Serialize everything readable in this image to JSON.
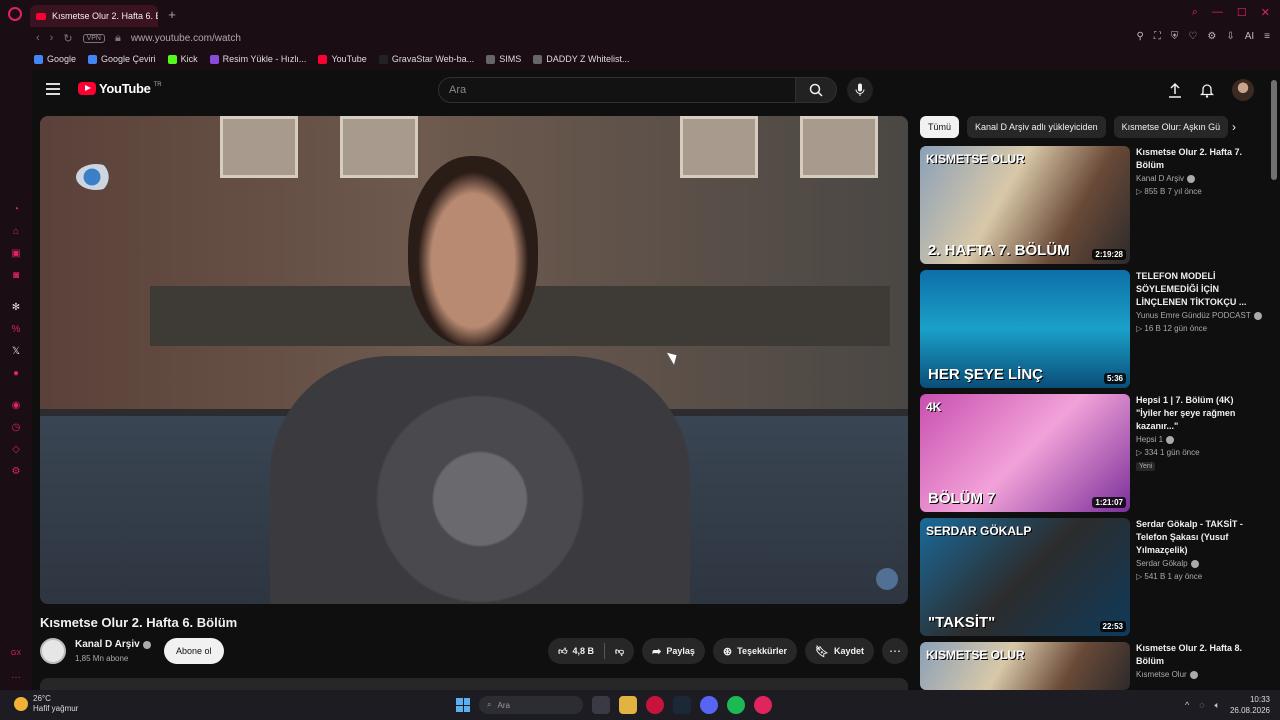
{
  "browser": {
    "tab_title": "Kısmetse Olur 2. Hafta 6. B",
    "new_tab": "+",
    "url": "www.youtube.com/watch",
    "vpn": "VPN",
    "ai_label": "AI",
    "bookmarks": [
      {
        "label": "Google",
        "color": "#4285f4"
      },
      {
        "label": "Google Çeviri",
        "color": "#4285f4"
      },
      {
        "label": "Kick",
        "color": "#53fc18"
      },
      {
        "label": "Resim Yükle - Hızlı...",
        "color": "#8a4bd8"
      },
      {
        "label": "YouTube",
        "color": "#ff0033"
      },
      {
        "label": "GravaStar Web-ba...",
        "color": "#222222"
      },
      {
        "label": "SIMS",
        "color": "#666666"
      },
      {
        "label": "DADDY Z Whitelist...",
        "color": "#666666"
      }
    ]
  },
  "youtube": {
    "logo_text": "YouTube",
    "logo_region": "TR",
    "search_placeholder": "Ara",
    "video": {
      "title": "Kısmetse Olur 2. Hafta 6. Bölüm",
      "channel": "Kanal D Arşiv",
      "subscribers": "1,85 Mn abone",
      "subscribe_label": "Abone ol",
      "likes": "4,8 B",
      "share_label": "Paylaş",
      "thanks_label": "Teşekkürler",
      "save_label": "Kaydet"
    },
    "chips": [
      "Tümü",
      "Kanal D Arşiv adlı yükleyiciden",
      "Kısmetse Olur: Aşkın Gü"
    ],
    "recommendations": [
      {
        "title": "Kısmetse Olur 2. Hafta 7. Bölüm",
        "channel": "Kanal D Arşiv",
        "meta": "▷ 855 B   7 yıl önce",
        "duration": "2:19:28",
        "thumb_top": "KISMETSE OLUR",
        "thumb_text": "2. HAFTA 7. BÖLÜM"
      },
      {
        "title": "TELEFON MODELİ SÖYLEMEDİĞİ İÇİN LİNÇLENEN TİKTOKÇU ...",
        "channel": "Yunus Emre Gündüz PODCAST",
        "meta": "▷ 16 B   12 gün önce",
        "duration": "5:36",
        "thumb_text": "HER ŞEYE LİNÇ"
      },
      {
        "title": "Hepsi 1 | 7. Bölüm (4K) \"İyiler her şeye rağmen kazanır...\"",
        "channel": "Hepsi 1",
        "meta": "▷ 334   1 gün önce",
        "badge": "Yeni",
        "duration": "1:21:07",
        "thumb_top": "4K",
        "thumb_text": "BÖLÜM 7"
      },
      {
        "title": "Serdar Gökalp - TAKSİT - Telefon Şakası (Yusuf Yılmazçelik)",
        "channel": "Serdar Gökalp",
        "meta": "▷ 541 B   1 ay önce",
        "duration": "22:53",
        "thumb_top": "SERDAR GÖKALP",
        "thumb_text": "\"TAKSİT\""
      },
      {
        "title": "Kısmetse Olur 2. Hafta 8. Bölüm",
        "channel": "Kısmetse Olur",
        "thumb_top": "KISMETSE OLUR"
      }
    ]
  },
  "taskbar": {
    "temperature": "26°C",
    "weather": "Hafif yağmur",
    "search_placeholder": "Ara",
    "time": "10:33",
    "date": "26.08.2026"
  }
}
